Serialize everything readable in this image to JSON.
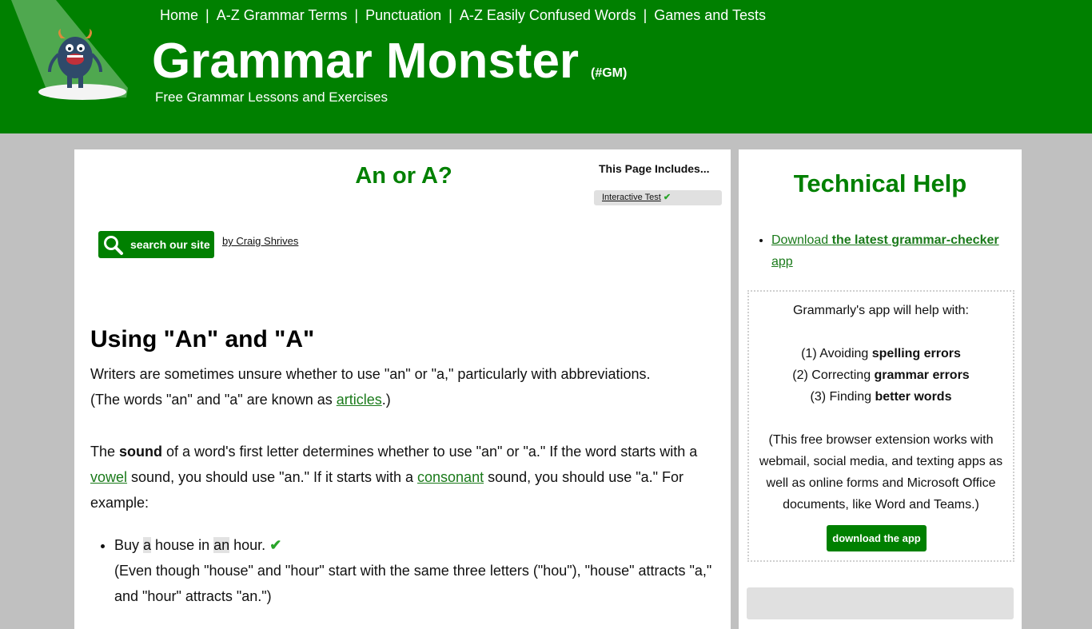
{
  "header": {
    "nav": [
      "Home",
      "A-Z Grammar Terms",
      "Punctuation",
      "A-Z Easily Confused Words",
      "Games and Tests"
    ],
    "nav_separator": "|",
    "site_title": "Grammar Monster",
    "site_tag": "(#GM)",
    "subtitle": "Free Grammar Lessons and Exercises",
    "logo_icon": "monster-spotlight-icon"
  },
  "main": {
    "page_title": "An or A?",
    "includes": {
      "title": "This Page Includes...",
      "item": "Interactive Test",
      "item_icon": "✔"
    },
    "search_button": "search our site",
    "author": "by Craig Shrives",
    "heading": "Using \"An\" and \"A\"",
    "intro_1": "Writers are sometimes unsure whether to use \"an\" or \"a,\" particularly with abbreviations.",
    "intro_2_pre": "(The words \"an\" and \"a\" are known as ",
    "intro_2_link": "articles",
    "intro_2_post": ".)",
    "rule": {
      "p1": "The ",
      "bold": "sound",
      "p2": " of a word's first letter determines whether to use \"an\" or \"a.\" If the word starts with a ",
      "link1": "vowel",
      "p3": " sound, you should use \"an.\" If it starts with a ",
      "link2": "consonant",
      "p4": " sound, you should use \"a.\" For example:"
    },
    "example": {
      "w1": "Buy ",
      "hl1": "a",
      "w2": " house in ",
      "hl2": "an",
      "w3": " hour. ",
      "check": "✔",
      "note": "(Even though \"house\" and \"hour\" start with the same three letters (\"hou\"), \"house\" attracts \"a,\" and \"hour\" attracts \"an.\")"
    }
  },
  "sidebar": {
    "title": "Technical Help",
    "link_pre": "Download ",
    "link_bold": "the latest grammar-checker",
    "link_post": " app",
    "promo": {
      "intro": "Grammarly's app will help with:",
      "items": [
        {
          "pre": "(1) Avoiding ",
          "bold": "spelling errors"
        },
        {
          "pre": "(2) Correcting ",
          "bold": "grammar errors"
        },
        {
          "pre": "(3) Finding ",
          "bold": "better words"
        }
      ],
      "note": "(This free browser extension works with webmail, social media, and texting apps as well as online forms and Microsoft Office documents, like Word and Teams.)",
      "button": "download the app"
    }
  },
  "colors": {
    "brand_green": "#008000",
    "link_green": "#1a7a1a",
    "background_grey": "#c0c0c0",
    "check_green": "#2aa52a"
  }
}
